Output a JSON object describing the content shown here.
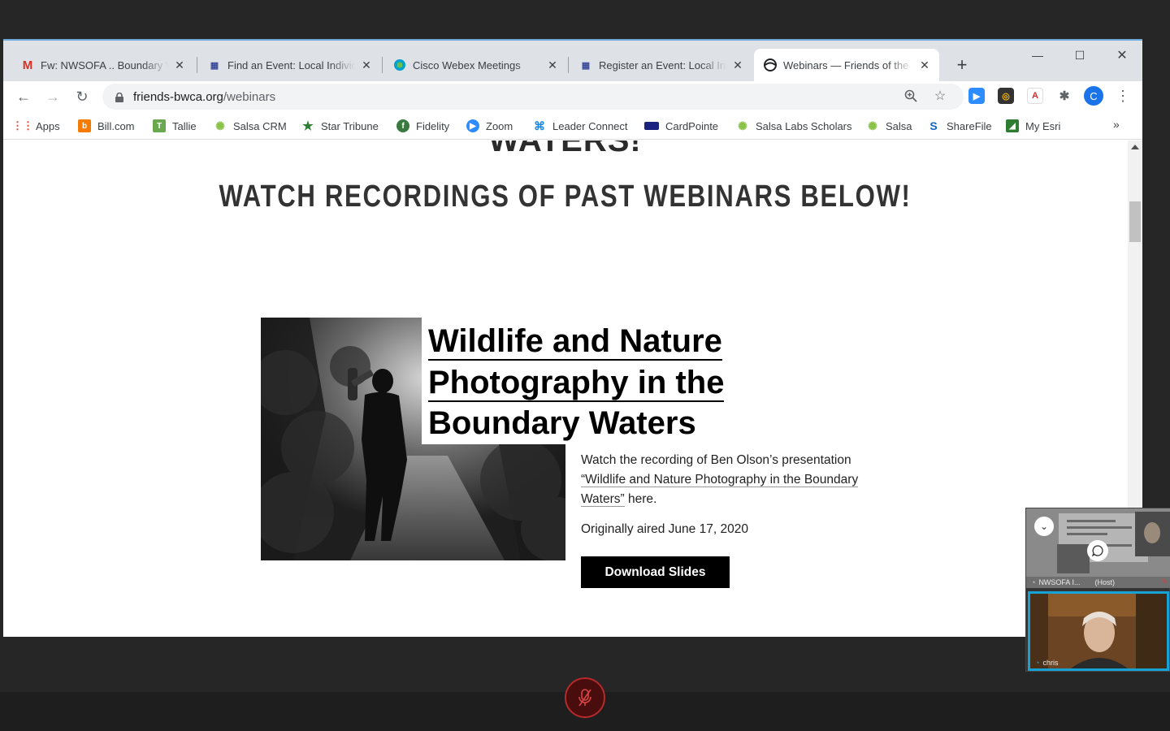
{
  "tabs": [
    {
      "title": "Fw: NWSOFA .. Boundary W",
      "icon": "gmail-icon"
    },
    {
      "title": "Find an Event: Local Individ",
      "icon": "grid-icon"
    },
    {
      "title": "Cisco Webex Meetings",
      "icon": "webex-icon"
    },
    {
      "title": "Register an Event: Local In",
      "icon": "grid-icon"
    },
    {
      "title": "Webinars — Friends of the",
      "icon": "globe-icon",
      "active": true
    }
  ],
  "omnibox": {
    "host": "friends-bwca.org",
    "path": "/webinars"
  },
  "bookmarks": [
    "Apps",
    "Bill.com",
    "Tallie",
    "Salsa CRM",
    "Star Tribune",
    "Fidelity",
    "Zoom",
    "Leader Connect",
    "CardPointe",
    "Salsa Labs Scholars",
    "Salsa",
    "ShareFile",
    "My Esri"
  ],
  "bookmarks_more": "»",
  "profile_initial": "C",
  "page": {
    "cut_heading": "WATERS!",
    "heading": "WATCH RECORDINGS OF PAST WEBINARS BELOW!",
    "card": {
      "title_lines": [
        "Wildlife and Nature",
        "Photography in the",
        "Boundary Waters"
      ],
      "desc_before": "Watch the recording of Ben Olson’s presentation ",
      "desc_link": "“Wildlife and Nature Photography in the Boundary Waters”",
      "desc_after": " here.",
      "aired": "Originally aired June 17, 2020",
      "button": "Download Slides"
    }
  },
  "webex": {
    "tile1_label": "NWSOFA I...",
    "tile1_role": "(Host)",
    "tile2_label": "chris"
  },
  "colors": {
    "accent": "#1a73e8",
    "webex_active_border": "#17a2d6",
    "mute_red": "#b52a2a"
  }
}
